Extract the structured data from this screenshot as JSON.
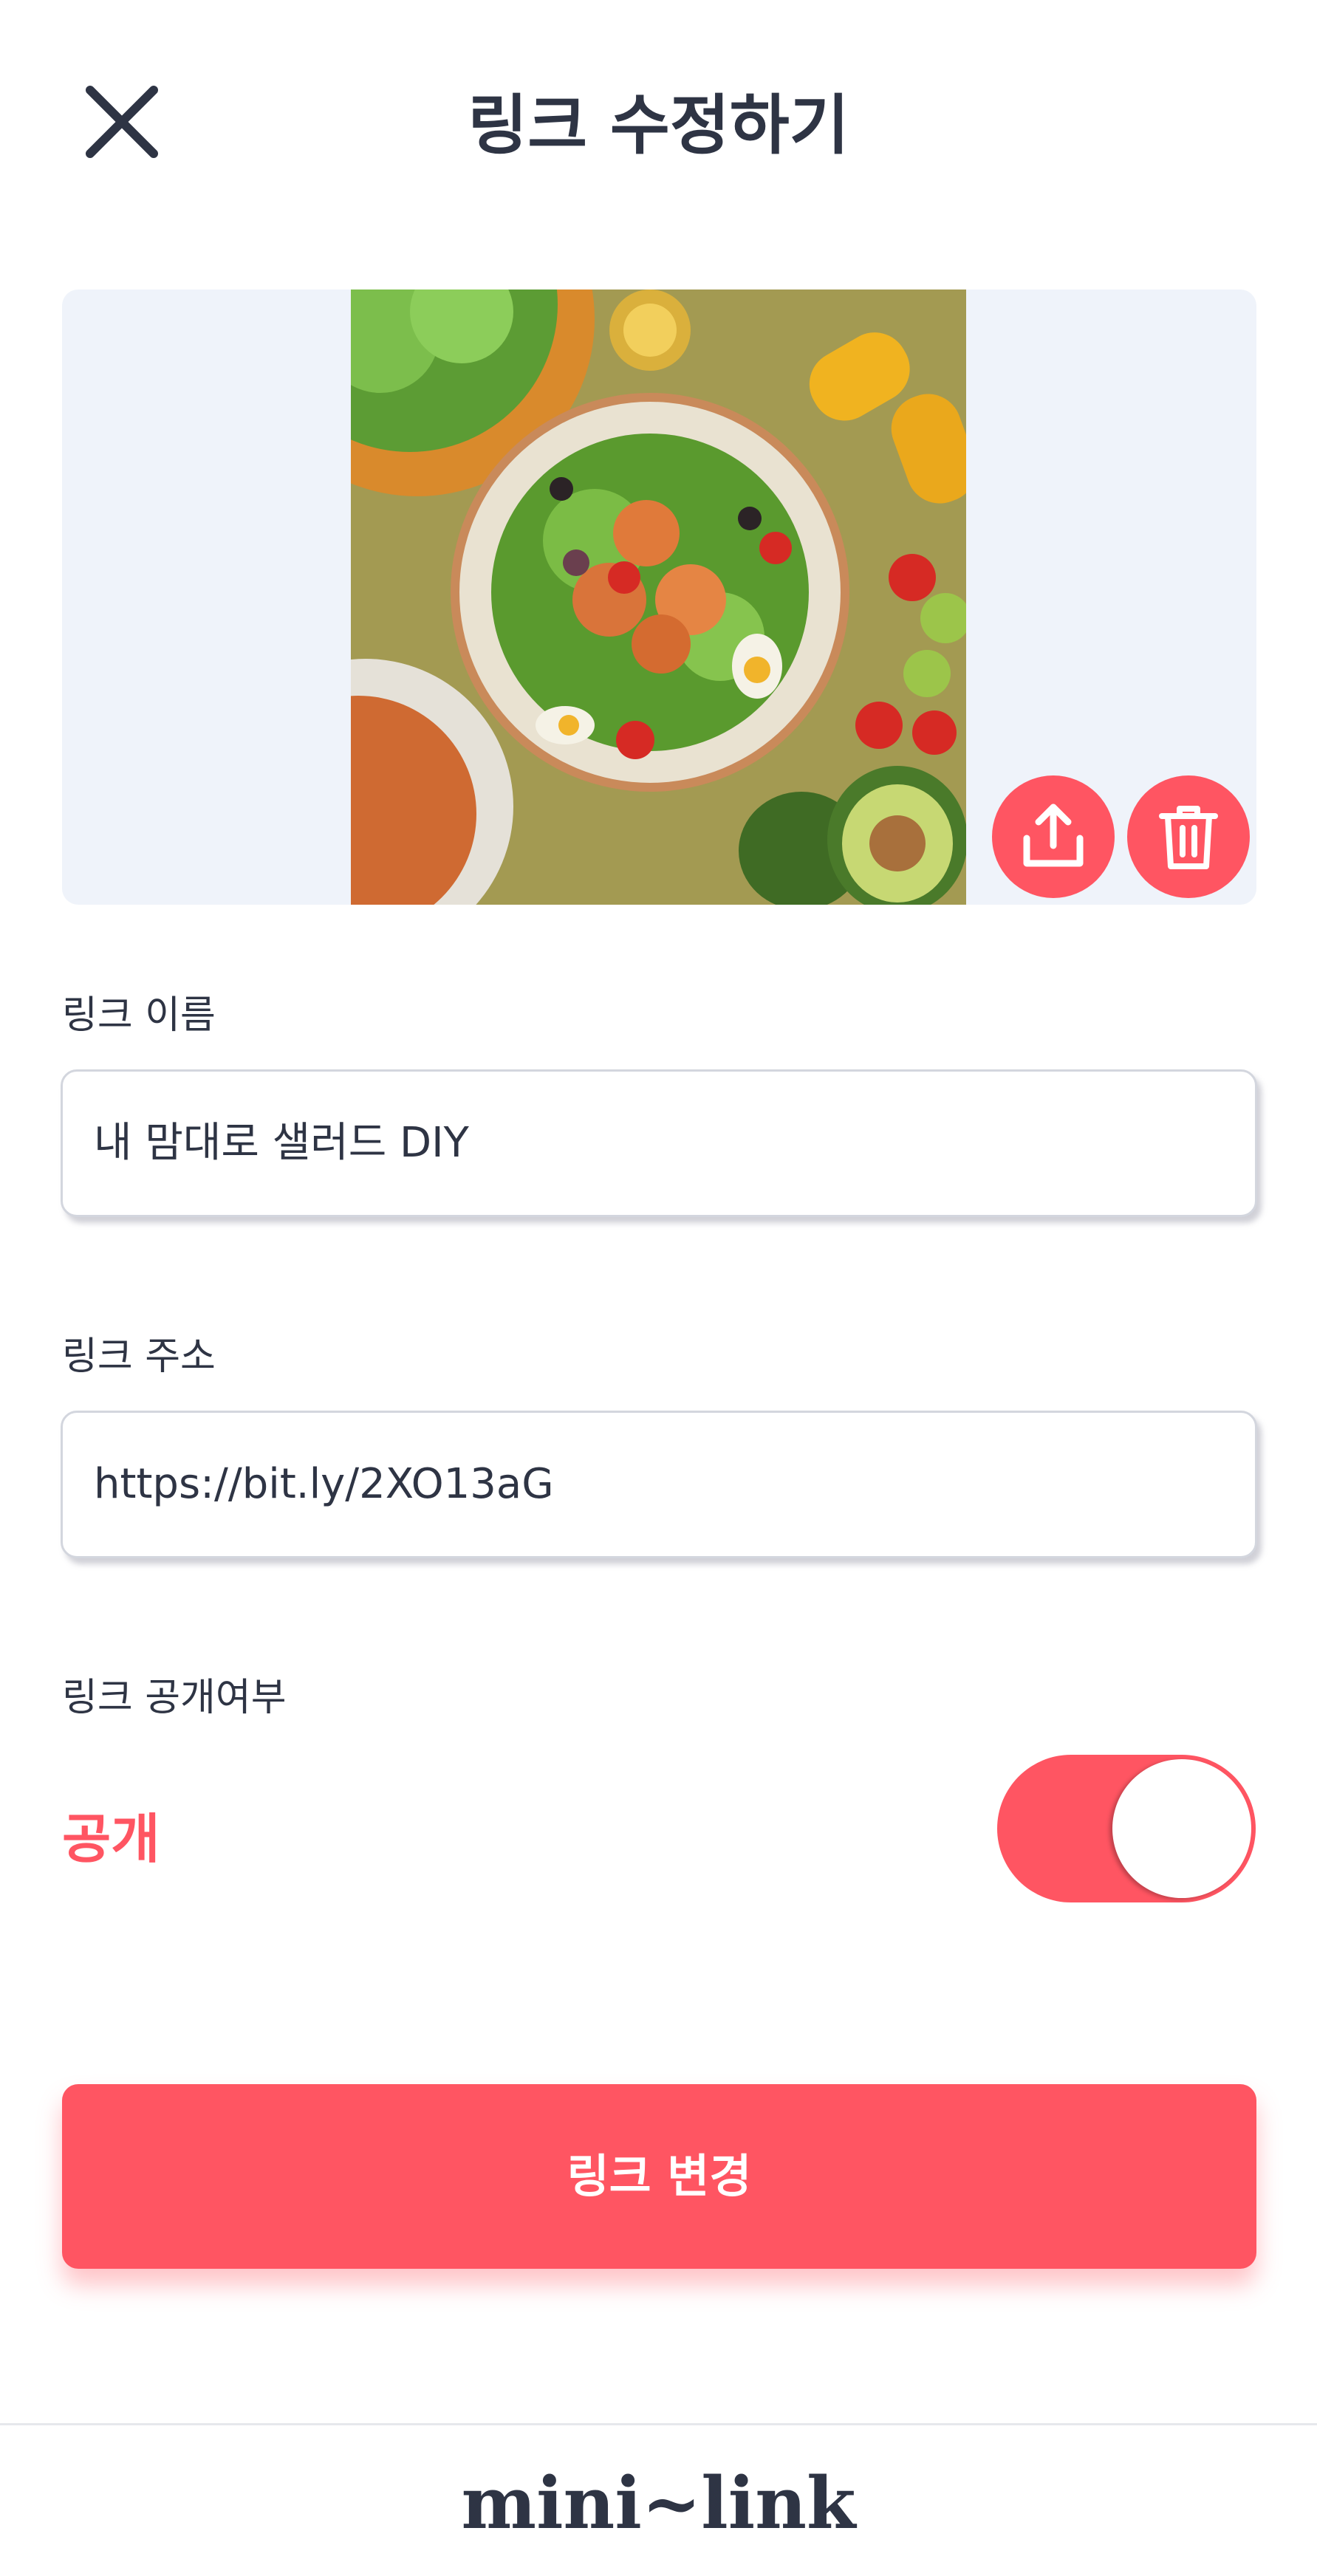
{
  "header": {
    "title": "링크 수정하기",
    "close_icon": "close-icon"
  },
  "image": {
    "description_icons": [
      "upload-icon",
      "trash-icon"
    ]
  },
  "form": {
    "name_label": "링크 이름",
    "name_value": "내 맘대로 샐러드 DIY",
    "url_label": "링크 주소",
    "url_value": "https://bit.ly/2XO13aG",
    "visibility_label": "링크 공개여부",
    "visibility_value": "공개",
    "visibility_on": true
  },
  "submit": {
    "label": "링크 변경"
  },
  "footer": {
    "logo": "mini~link"
  },
  "colors": {
    "accent": "#ff5562",
    "text": "#2e3444",
    "panel": "#eff3fa"
  }
}
